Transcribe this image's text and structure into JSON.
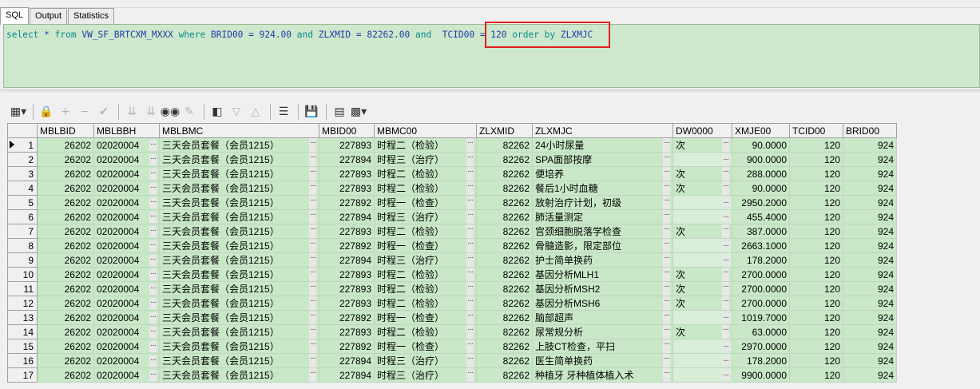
{
  "tabs": [
    "SQL",
    "Output",
    "Statistics"
  ],
  "sql": {
    "parts": [
      {
        "t": "kw",
        "v": "select"
      },
      {
        "t": "tx",
        "v": " * "
      },
      {
        "t": "kw",
        "v": "from"
      },
      {
        "t": "tx",
        "v": " VW_SF_BRTCXM_MXXX "
      },
      {
        "t": "kw",
        "v": "where"
      },
      {
        "t": "tx",
        "v": " BRID00 = 924.00 "
      },
      {
        "t": "kw",
        "v": "and"
      },
      {
        "t": "tx",
        "v": " ZLXMID = 82262.00 "
      },
      {
        "t": "kw",
        "v": "and"
      },
      {
        "t": "tx",
        "v": "  TCID00 = 120 "
      },
      {
        "t": "kw",
        "v": "order by"
      },
      {
        "t": "tx",
        "v": " ZLXMJC"
      }
    ]
  },
  "columns": [
    "MBLBID",
    "MBLBBH",
    "MBLBMC",
    "MBID00",
    "MBMC00",
    "ZLXMID",
    "ZLXMJC",
    "DW0000",
    "XMJE00",
    "TCID00",
    "BRID00"
  ],
  "rows": [
    [
      "1",
      "26202",
      "02020004",
      "三天会员套餐（会员1215）",
      "227893",
      "时程二（检验）",
      "82262",
      "24小时尿量",
      "次",
      "90.0000",
      "120",
      "924"
    ],
    [
      "2",
      "26202",
      "02020004",
      "三天会员套餐（会员1215）",
      "227894",
      "时程三（治疗）",
      "82262",
      "SPA面部按摩",
      "",
      "900.0000",
      "120",
      "924"
    ],
    [
      "3",
      "26202",
      "02020004",
      "三天会员套餐（会员1215）",
      "227893",
      "时程二（检验）",
      "82262",
      "便培养",
      "次",
      "288.0000",
      "120",
      "924"
    ],
    [
      "4",
      "26202",
      "02020004",
      "三天会员套餐（会员1215）",
      "227893",
      "时程二（检验）",
      "82262",
      "餐后1小时血糖",
      "次",
      "90.0000",
      "120",
      "924"
    ],
    [
      "5",
      "26202",
      "02020004",
      "三天会员套餐（会员1215）",
      "227892",
      "时程一（检查）",
      "82262",
      "放射治疗计划，初级",
      "",
      "2950.2000",
      "120",
      "924"
    ],
    [
      "6",
      "26202",
      "02020004",
      "三天会员套餐（会员1215）",
      "227894",
      "时程三（治疗）",
      "82262",
      "肺活量测定",
      "",
      "455.4000",
      "120",
      "924"
    ],
    [
      "7",
      "26202",
      "02020004",
      "三天会员套餐（会员1215）",
      "227893",
      "时程二（检验）",
      "82262",
      "宫颈细胞脱落学检查",
      "次",
      "387.0000",
      "120",
      "924"
    ],
    [
      "8",
      "26202",
      "02020004",
      "三天会员套餐（会员1215）",
      "227892",
      "时程一（检查）",
      "82262",
      "骨髓造影，限定部位",
      "",
      "2663.1000",
      "120",
      "924"
    ],
    [
      "9",
      "26202",
      "02020004",
      "三天会员套餐（会员1215）",
      "227894",
      "时程三（治疗）",
      "82262",
      "护士简单换药",
      "",
      "178.2000",
      "120",
      "924"
    ],
    [
      "10",
      "26202",
      "02020004",
      "三天会员套餐（会员1215）",
      "227893",
      "时程二（检验）",
      "82262",
      "基因分析MLH1",
      "次",
      "2700.0000",
      "120",
      "924"
    ],
    [
      "11",
      "26202",
      "02020004",
      "三天会员套餐（会员1215）",
      "227893",
      "时程二（检验）",
      "82262",
      "基因分析MSH2",
      "次",
      "2700.0000",
      "120",
      "924"
    ],
    [
      "12",
      "26202",
      "02020004",
      "三天会员套餐（会员1215）",
      "227893",
      "时程二（检验）",
      "82262",
      "基因分析MSH6",
      "次",
      "2700.0000",
      "120",
      "924"
    ],
    [
      "13",
      "26202",
      "02020004",
      "三天会员套餐（会员1215）",
      "227892",
      "时程一（检查）",
      "82262",
      "脑部超声",
      "",
      "1019.7000",
      "120",
      "924"
    ],
    [
      "14",
      "26202",
      "02020004",
      "三天会员套餐（会员1215）",
      "227893",
      "时程二（检验）",
      "82262",
      "尿常规分析",
      "次",
      "63.0000",
      "120",
      "924"
    ],
    [
      "15",
      "26202",
      "02020004",
      "三天会员套餐（会员1215）",
      "227892",
      "时程一（检查）",
      "82262",
      "上肢CT检查，平扫",
      "",
      "2970.0000",
      "120",
      "924"
    ],
    [
      "16",
      "26202",
      "02020004",
      "三天会员套餐（会员1215）",
      "227894",
      "时程三（治疗）",
      "82262",
      "医生简单换药",
      "",
      "178.2000",
      "120",
      "924"
    ],
    [
      "17",
      "26202",
      "02020004",
      "三天会员套餐（会员1215）",
      "227894",
      "时程三（治疗）",
      "82262",
      "种植牙 牙种植体植入术",
      "",
      "9900.0000",
      "120",
      "924"
    ]
  ],
  "colors": {
    "grid_bg": "#c8e8c8",
    "sql_bg": "#cde8cd",
    "highlight": "#e02020",
    "keyword": "#0b8a8a",
    "sql_text": "#1f3fa6"
  }
}
